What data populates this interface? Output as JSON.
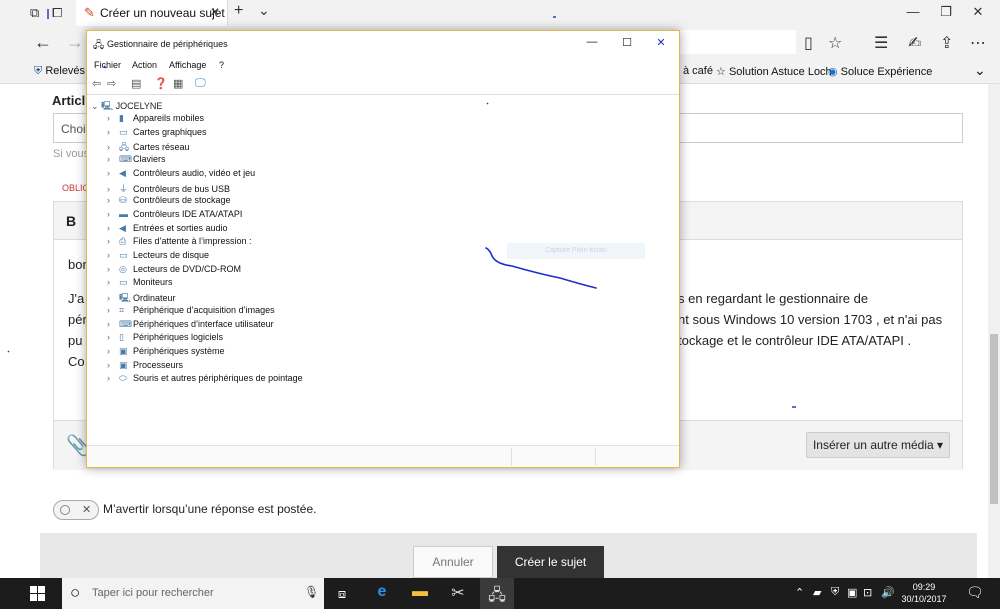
{
  "browser": {
    "tab_title": "Créer un nouveau sujet",
    "tab_close": "✕",
    "new_tab": "+",
    "tab_menu": "⌄",
    "favorites": [
      {
        "label": "Relevés A",
        "icon": "shield-icon"
      },
      {
        "label": "à café",
        "icon": ""
      },
      {
        "label": "Solution Astuce Loch",
        "icon": "star-icon"
      },
      {
        "label": "Soluce Expérience",
        "icon": "globe-icon"
      }
    ]
  },
  "page": {
    "article_label": "Articl",
    "choose_placeholder": "Chois",
    "hint": "Si vous",
    "required": "OBLIG",
    "bold": "B",
    "body_lines": [
      "bon",
      "J'a",
      "pér",
      "pu",
      "Co"
    ],
    "body_right_lines": [
      "s en regardant le gestionnaire de",
      "nt sous Windows 10 version 1703 , et n'ai pas",
      "tockage  et le contrôleur IDE ATA/ATAPI ."
    ],
    "insert_media": "Insérer un autre média ▾",
    "notify_label": "M’avertir lorsqu’une réponse est postée.",
    "cancel": "Annuler",
    "create": "Créer le sujet"
  },
  "device_manager": {
    "title": "Gestionnaire de périphériques",
    "menu": [
      "Fichier",
      "Action",
      "Affichage",
      "?"
    ],
    "root": "JOCELYNE",
    "items": [
      {
        "label": "Appareils mobiles",
        "icon": "mobile-device-icon"
      },
      {
        "label": "Cartes graphiques",
        "icon": "display-adapter-icon"
      },
      {
        "label": "Cartes réseau",
        "icon": "network-adapter-icon"
      },
      {
        "label": "Claviers",
        "icon": "keyboard-icon"
      },
      {
        "label": "Contrôleurs audio, vidéo et jeu",
        "icon": "speaker-icon"
      },
      {
        "label": "Contrôleurs de bus USB",
        "icon": "usb-icon"
      },
      {
        "label": "Contrôleurs de stockage",
        "icon": "storage-controller-icon"
      },
      {
        "label": "Contrôleurs IDE ATA/ATAPI",
        "icon": "ide-controller-icon"
      },
      {
        "label": "Entrées et sorties audio",
        "icon": "audio-io-icon"
      },
      {
        "label": "Files d’attente à l’impression :",
        "icon": "printer-icon"
      },
      {
        "label": "Lecteurs de disque",
        "icon": "disk-drive-icon"
      },
      {
        "label": "Lecteurs de DVD/CD-ROM",
        "icon": "dvd-drive-icon"
      },
      {
        "label": "Moniteurs",
        "icon": "monitor-icon"
      },
      {
        "label": "Ordinateur",
        "icon": "computer-icon"
      },
      {
        "label": "Périphérique d’acquisition d’images",
        "icon": "scanner-icon"
      },
      {
        "label": "Périphériques d’interface utilisateur",
        "icon": "hid-icon"
      },
      {
        "label": "Périphériques logiciels",
        "icon": "software-device-icon"
      },
      {
        "label": "Périphériques système",
        "icon": "system-device-icon"
      },
      {
        "label": "Processeurs",
        "icon": "processor-icon"
      },
      {
        "label": "Souris et autres périphériques de pointage",
        "icon": "mouse-icon"
      }
    ],
    "ghost_text": "Capture Plein écran"
  },
  "taskbar": {
    "search_placeholder": "Taper ici pour rechercher",
    "time": "09:29",
    "date": "30/10/2017"
  },
  "colors": {
    "window_border": "#e2b74c",
    "pen_stroke": "#1b2fd1",
    "taskbar": "#1c1c1c",
    "create_button": "#333333"
  }
}
